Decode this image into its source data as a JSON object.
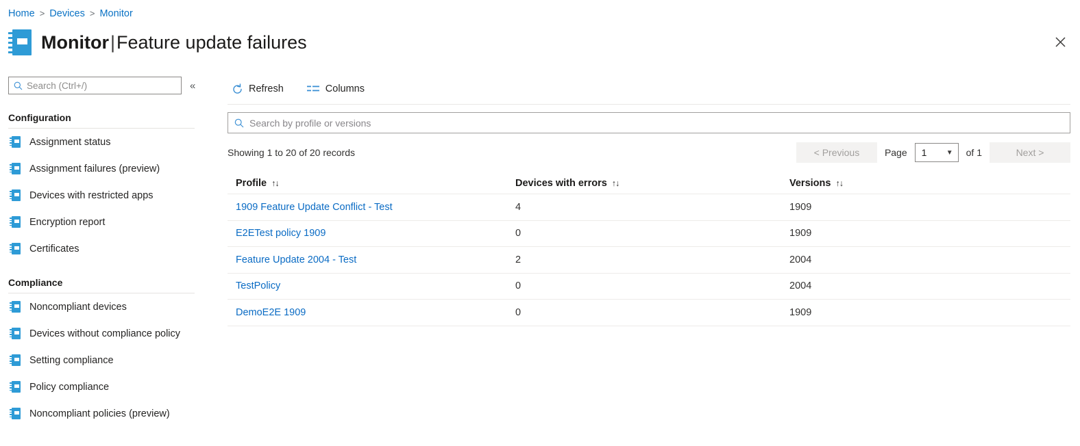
{
  "breadcrumb": {
    "items": [
      {
        "label": "Home"
      },
      {
        "label": "Devices"
      },
      {
        "label": "Monitor"
      }
    ],
    "separator": ">"
  },
  "header": {
    "icon": "report-notebook-icon",
    "title_primary": "Monitor",
    "title_divider": "|",
    "title_secondary": "Feature update failures",
    "close_label": "✕"
  },
  "sidebar": {
    "search": {
      "placeholder": "Search (Ctrl+/)",
      "value": "",
      "icon": "search-icon"
    },
    "collapse_icon": "«",
    "groups": [
      {
        "title": "Configuration",
        "items": [
          {
            "label": "Assignment status"
          },
          {
            "label": "Assignment failures (preview)"
          },
          {
            "label": "Devices with restricted apps"
          },
          {
            "label": "Encryption report"
          },
          {
            "label": "Certificates"
          }
        ]
      },
      {
        "title": "Compliance",
        "items": [
          {
            "label": "Noncompliant devices"
          },
          {
            "label": "Devices without compliance policy"
          },
          {
            "label": "Setting compliance"
          },
          {
            "label": "Policy compliance"
          },
          {
            "label": "Noncompliant policies (preview)"
          }
        ]
      }
    ]
  },
  "toolbar": {
    "refresh_label": "Refresh",
    "refresh_icon": "refresh-icon",
    "columns_label": "Columns",
    "columns_icon": "columns-icon"
  },
  "table_search": {
    "placeholder": "Search by profile or versions",
    "value": "",
    "icon": "search-icon"
  },
  "pagination": {
    "records_text": "Showing 1 to 20 of 20 records",
    "previous_label": "< Previous",
    "next_label": "Next >",
    "page_label": "Page",
    "page_value": "1",
    "of_text": "of 1",
    "chevron_icon": "chevron-down-icon"
  },
  "table": {
    "columns": [
      {
        "label": "Profile",
        "sort_icon": "↑↓"
      },
      {
        "label": "Devices with errors",
        "sort_icon": "↑↓"
      },
      {
        "label": "Versions",
        "sort_icon": "↑↓"
      }
    ],
    "rows": [
      {
        "profile": "1909 Feature Update Conflict - Test",
        "devices_with_errors": "4",
        "versions": "1909"
      },
      {
        "profile": "E2ETest policy 1909",
        "devices_with_errors": "0",
        "versions": "1909"
      },
      {
        "profile": "Feature Update 2004 - Test",
        "devices_with_errors": "2",
        "versions": "2004"
      },
      {
        "profile": "TestPolicy",
        "devices_with_errors": "0",
        "versions": "2004"
      },
      {
        "profile": "DemoE2E 1909",
        "devices_with_errors": "0",
        "versions": "1909"
      }
    ]
  },
  "colors": {
    "link": "#0a6bc4",
    "breadcrumb_link": "#0a72c4",
    "icon_blue": "#2e9bd6",
    "text": "#323130",
    "border": "#edebe9"
  }
}
